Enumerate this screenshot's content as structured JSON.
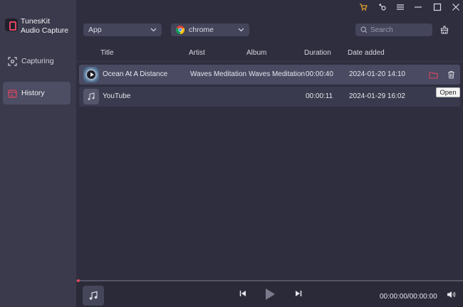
{
  "app": {
    "name_line1": "TunesKit",
    "name_line2": "Audio Capture",
    "accent": "#e0455e"
  },
  "sidebar": {
    "items": [
      {
        "label": "Capturing",
        "icon": "capture-icon",
        "active": false
      },
      {
        "label": "History",
        "icon": "history-icon",
        "active": true
      }
    ]
  },
  "toolbar": {
    "app_filter": "App",
    "source": "chrome",
    "search_placeholder": "Search"
  },
  "table": {
    "columns": [
      "Title",
      "Artist",
      "Album",
      "Duration",
      "Date added"
    ],
    "rows": [
      {
        "title": "Ocean At A Distance",
        "artist": "Waves Meditation",
        "album": "Waves Meditation",
        "duration": "00:00:40",
        "date_added": "2024-01-20 14:10"
      },
      {
        "title": "YouTube",
        "artist": "",
        "album": "",
        "duration": "00:00:11",
        "date_added": "2024-01-29 16:02"
      }
    ]
  },
  "tooltip": "Open",
  "player": {
    "time": "00:00:00/00:00:00",
    "progress": 0
  }
}
